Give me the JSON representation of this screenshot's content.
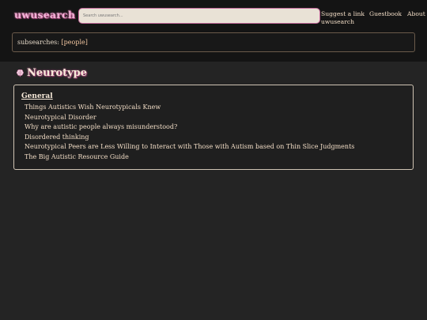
{
  "header": {
    "logo": "uwusearch",
    "search_placeholder": "Search uwusearch...",
    "nav": {
      "suggest_line1": "Suggest a link",
      "suggest_line2": "uwusearch",
      "guestbook": "Guestbook",
      "about": "About"
    }
  },
  "subsearches": {
    "label": "subsearches:",
    "link": "[people]"
  },
  "page": {
    "title": "Neurotype",
    "title_icon": "brain-icon"
  },
  "results": {
    "section": "General",
    "items": [
      "Things Autistics Wish Neurotypicals Knew",
      "Neurotypical Disorder",
      "Why are autistic people always misunderstood?",
      "Disordered thinking",
      "Neurotypical Peers are Less Willing to Interact with Those with Autism based on Thin Slice Judgments",
      "The Big Autistic Resource Guide"
    ]
  },
  "colors": {
    "background": "#242424",
    "header": "#141414",
    "logo": "#f0b4d6",
    "search_border": "#c46a9a",
    "text": "#f2ddc6"
  }
}
